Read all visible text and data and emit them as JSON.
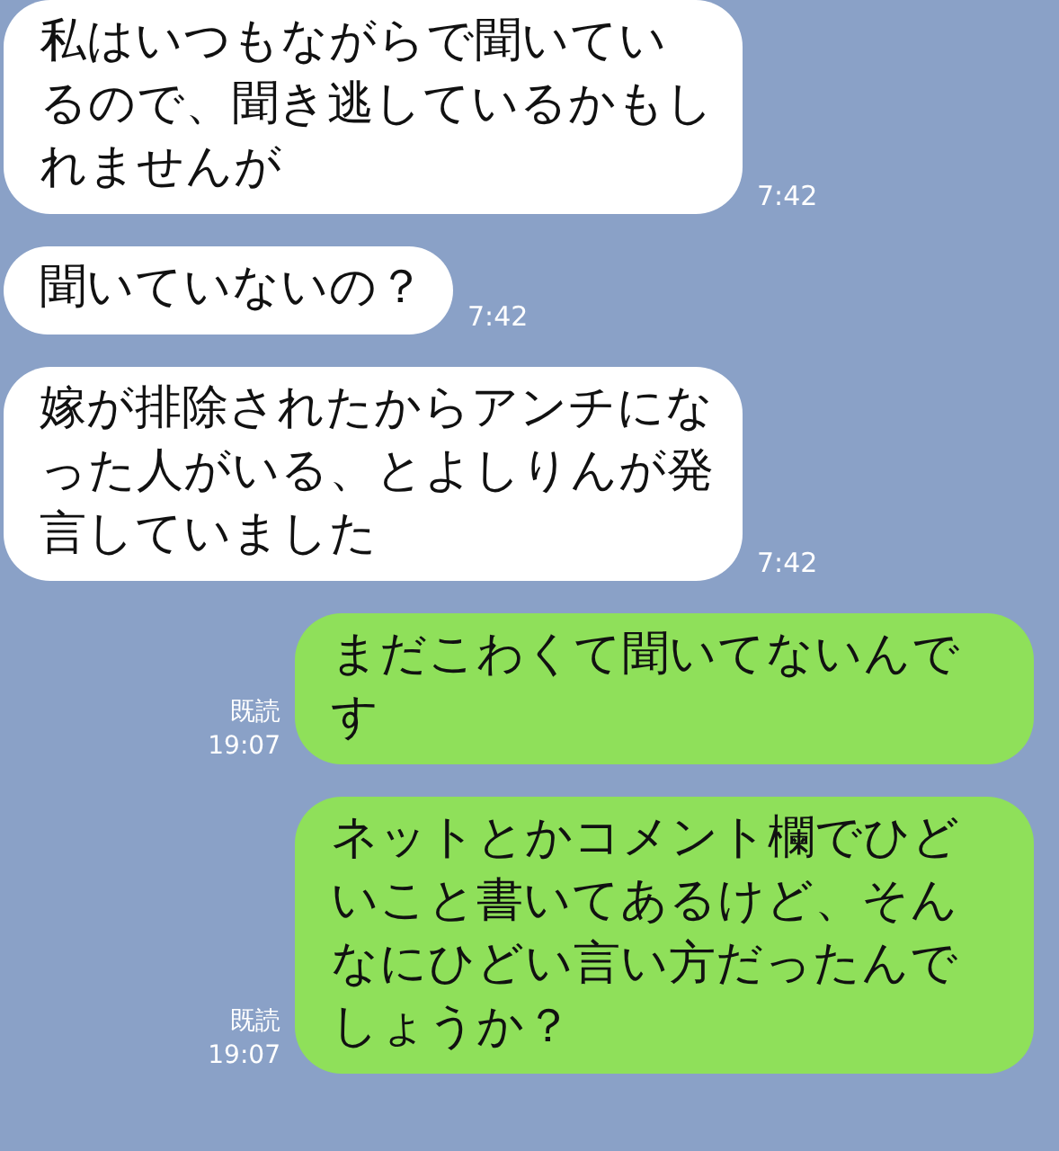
{
  "messages": [
    {
      "kind": "incoming",
      "text": "私はいつもながらで聞いているので、聞き逃しているかもしれませんが",
      "time": "7:42"
    },
    {
      "kind": "incoming",
      "text": "聞いていないの？",
      "time": "7:42"
    },
    {
      "kind": "incoming",
      "text": "嫁が排除されたからアンチになった人がいる、とよしりんが発言していました",
      "time": "7:42"
    },
    {
      "kind": "outgoing",
      "text": "まだこわくて聞いてないんです",
      "read": "既読",
      "time": "19:07"
    },
    {
      "kind": "outgoing",
      "text": "ネットとかコメント欄でひどいこと書いてあるけど、そんなにひどい言い方だったんでしょうか？",
      "read": "既読",
      "time": "19:07"
    }
  ]
}
